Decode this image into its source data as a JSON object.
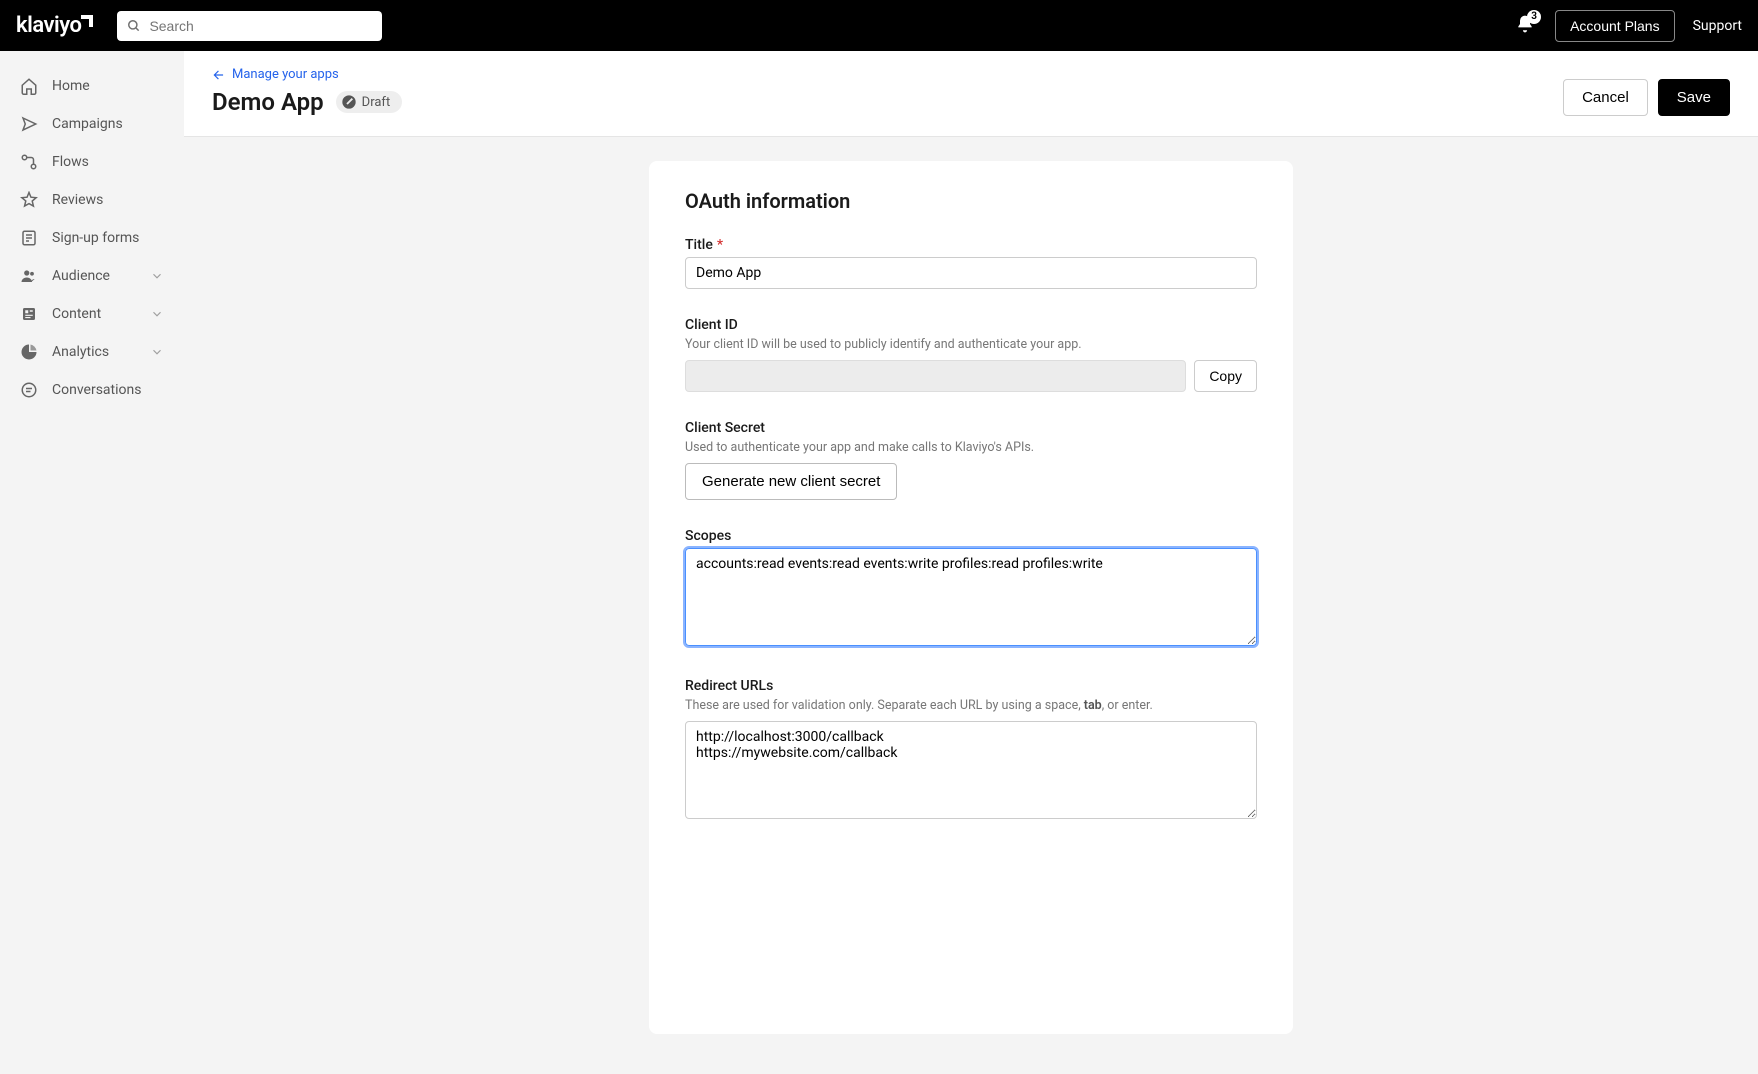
{
  "navbar": {
    "logo": "klaviyo",
    "search_placeholder": "Search",
    "notification_count": "3",
    "account_plans": "Account Plans",
    "support": "Support"
  },
  "sidebar": {
    "items": [
      {
        "label": "Home",
        "icon": "home",
        "expandable": false
      },
      {
        "label": "Campaigns",
        "icon": "campaigns",
        "expandable": false
      },
      {
        "label": "Flows",
        "icon": "flows",
        "expandable": false
      },
      {
        "label": "Reviews",
        "icon": "star",
        "expandable": false
      },
      {
        "label": "Sign-up forms",
        "icon": "form",
        "expandable": false
      },
      {
        "label": "Audience",
        "icon": "audience",
        "expandable": true
      },
      {
        "label": "Content",
        "icon": "content",
        "expandable": true
      },
      {
        "label": "Analytics",
        "icon": "analytics",
        "expandable": true
      },
      {
        "label": "Conversations",
        "icon": "conversations",
        "expandable": false
      }
    ]
  },
  "header": {
    "back_label": "Manage your apps",
    "title": "Demo App",
    "status": "Draft",
    "cancel": "Cancel",
    "save": "Save"
  },
  "form": {
    "section_title": "OAuth information",
    "title_label": "Title",
    "title_value": "Demo App",
    "client_id_label": "Client ID",
    "client_id_helper": "Your client ID will be used to publicly identify and authenticate your app.",
    "client_id_value": "",
    "copy": "Copy",
    "client_secret_label": "Client Secret",
    "client_secret_helper": "Used to authenticate your app and make calls to Klaviyo's APIs.",
    "generate_secret": "Generate new client secret",
    "scopes_label": "Scopes",
    "scopes_value": "accounts:read events:read events:write profiles:read profiles:write",
    "redirect_label": "Redirect URLs",
    "redirect_helper_pre": "These are used for validation only. Separate each URL by using a space, ",
    "redirect_helper_bold": "tab",
    "redirect_helper_post": ", or enter.",
    "redirect_value": "http://localhost:3000/callback\nhttps://mywebsite.com/callback"
  }
}
